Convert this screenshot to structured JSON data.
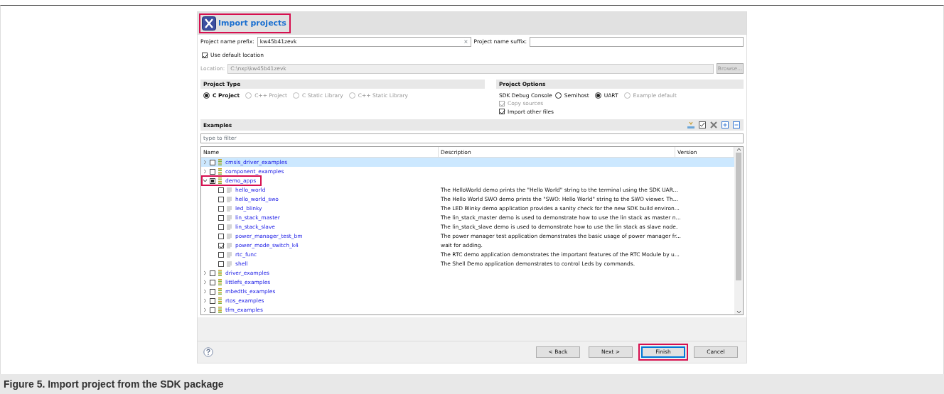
{
  "dialog": {
    "title": "Import projects",
    "title_highlighted": true,
    "prefix": {
      "label": "Project name prefix:",
      "value": "kw45b41zevk",
      "clear": "×"
    },
    "suffix": {
      "label": "Project name suffix:"
    },
    "use_default_location": {
      "label": "Use default location",
      "checked": true
    },
    "location": {
      "label": "Location:",
      "value": "C:\\nxp\\kw45b41zevk",
      "disabled": true,
      "browse": "Browse..."
    },
    "project_type": {
      "heading": "Project Type",
      "options": [
        {
          "label": "C Project",
          "selected": true,
          "disabled": false
        },
        {
          "label": "C++ Project",
          "selected": false,
          "disabled": true
        },
        {
          "label": "C Static Library",
          "selected": false,
          "disabled": true
        },
        {
          "label": "C++ Static Library",
          "selected": false,
          "disabled": true
        }
      ]
    },
    "project_options": {
      "heading": "Project Options",
      "console_label": "SDK Debug Console",
      "console_options": [
        {
          "label": "Semihost",
          "selected": false,
          "disabled": false
        },
        {
          "label": "UART",
          "selected": true,
          "disabled": false
        },
        {
          "label": "Example default",
          "selected": false,
          "disabled": true
        }
      ],
      "checks": [
        {
          "label": "Copy sources",
          "checked": true,
          "disabled": true
        },
        {
          "label": "Import other files",
          "checked": true,
          "disabled": false
        }
      ]
    },
    "examples": {
      "heading": "Examples",
      "filter_placeholder": "type to filter",
      "columns": [
        "Name",
        "Description",
        "Version"
      ],
      "rows": [
        {
          "kind": "group",
          "name": "cmsis_driver_examples",
          "checked": false,
          "partial": false,
          "expanded": false,
          "selected": true,
          "highlighted": false
        },
        {
          "kind": "group",
          "name": "component_examples",
          "checked": false,
          "partial": false,
          "expanded": false,
          "selected": false,
          "highlighted": false
        },
        {
          "kind": "group",
          "name": "demo_apps",
          "checked": false,
          "partial": true,
          "expanded": true,
          "selected": false,
          "highlighted": true,
          "children": [
            {
              "kind": "item",
              "name": "hello_world",
              "description": "The HelloWorld demo prints the \"Hello World\" string to the terminal using the SDK UAR...",
              "checked": false
            },
            {
              "kind": "item",
              "name": "hello_world_swo",
              "description": "The Hello World SWO demo prints the \"SWO: Hello World\" string to the SWO viewer. Th...",
              "checked": false
            },
            {
              "kind": "item",
              "name": "led_blinky",
              "description": "The LED Blinky demo application provides a sanity check for the new SDK build environ...",
              "checked": false
            },
            {
              "kind": "item",
              "name": "lin_stack_master",
              "description": "The lin_stack_master demo is used to demonstrate how to use the lin stack as master n...",
              "checked": false
            },
            {
              "kind": "item",
              "name": "lin_stack_slave",
              "description": "The lin_stack_slave demo is used to demonstrate how to use the lin stack as slave node.",
              "checked": false
            },
            {
              "kind": "item",
              "name": "power_manager_test_bm",
              "description": "The power manager test application demonstrates the basic usage of power manager fr...",
              "checked": false
            },
            {
              "kind": "item",
              "name": "power_mode_switch_k4",
              "description": "wait for adding.",
              "checked": true
            },
            {
              "kind": "item",
              "name": "rtc_func",
              "description": "The RTC demo application demonstrates the important features of the RTC Module by u...",
              "checked": false
            },
            {
              "kind": "item",
              "name": "shell",
              "description": "The Shell Demo application demonstrates to control Leds by commands.",
              "checked": false
            }
          ]
        },
        {
          "kind": "group",
          "name": "driver_examples",
          "checked": false,
          "partial": false,
          "expanded": false,
          "selected": false,
          "highlighted": false
        },
        {
          "kind": "group",
          "name": "littlefs_examples",
          "checked": false,
          "partial": false,
          "expanded": false,
          "selected": false,
          "highlighted": false
        },
        {
          "kind": "group",
          "name": "mbedtls_examples",
          "checked": false,
          "partial": false,
          "expanded": false,
          "selected": false,
          "highlighted": false
        },
        {
          "kind": "group",
          "name": "rtos_examples",
          "checked": false,
          "partial": false,
          "expanded": false,
          "selected": false,
          "highlighted": false
        },
        {
          "kind": "group",
          "name": "tfm_examples",
          "checked": false,
          "partial": false,
          "expanded": false,
          "selected": false,
          "highlighted": false
        }
      ]
    },
    "buttons": [
      {
        "label": "< Back",
        "default": false,
        "highlighted": false
      },
      {
        "label": "Next >",
        "default": false,
        "highlighted": false
      },
      {
        "label": "Finish",
        "default": true,
        "highlighted": true
      },
      {
        "label": "Cancel",
        "default": false,
        "highlighted": false
      }
    ]
  },
  "caption": "Figure 5.  Import project from the SDK package"
}
